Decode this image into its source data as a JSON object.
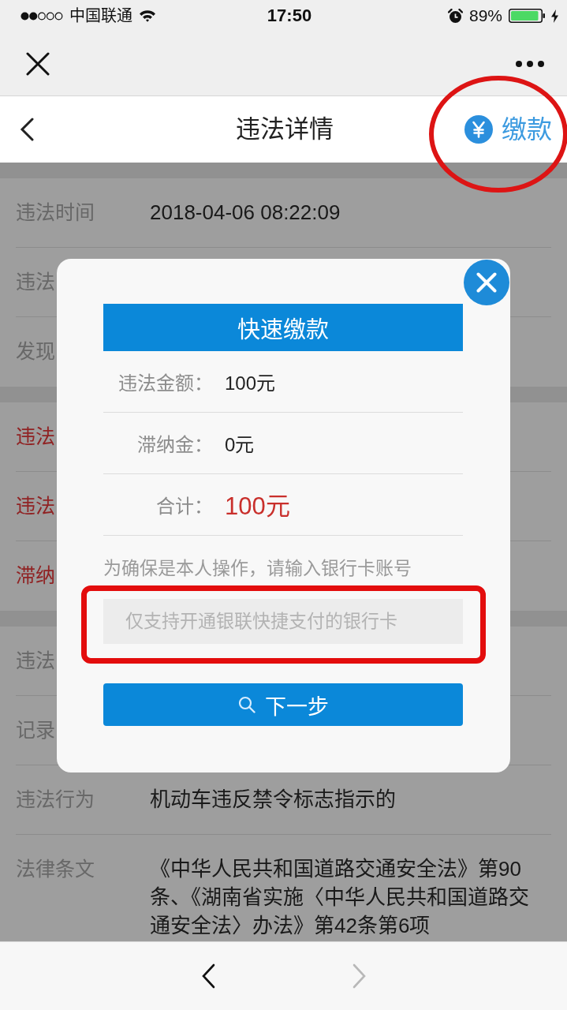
{
  "status_bar": {
    "carrier": "中国联通",
    "time": "17:50",
    "battery": "89%"
  },
  "header": {
    "title": "违法详情",
    "pay_action": {
      "label": "缴款",
      "highlighted": true
    }
  },
  "sections": [
    {
      "rows": [
        {
          "label": "违法时间",
          "value": "2018-04-06 08:22:09",
          "kind": "plain"
        },
        {
          "label": "违法",
          "kind": "plain"
        },
        {
          "label": "发现",
          "kind": "plain"
        }
      ]
    },
    {
      "rows": [
        {
          "label": "违法",
          "kind": "alert"
        },
        {
          "label": "违法",
          "kind": "alert"
        },
        {
          "label": "滞纳",
          "kind": "alert"
        }
      ]
    },
    {
      "rows": [
        {
          "label": "违法",
          "kind": "plain"
        },
        {
          "label": "记录",
          "kind": "plain"
        },
        {
          "label": "违法行为",
          "value": "机动车违反禁令标志指示的",
          "kind": "plain"
        },
        {
          "label": "法律条文",
          "value": "《中华人民共和国道路交通安全法》第90条、《湖南省实施〈中华人民共和国道路交通安全法〉办法》第42条第6项",
          "kind": "plain"
        }
      ]
    }
  ],
  "dialog": {
    "title": "快速缴款",
    "fees": [
      {
        "label": "违法金额：",
        "value": "100元",
        "kind": "amount"
      },
      {
        "label": "滞纳金：",
        "value": "0元",
        "kind": "amount"
      },
      {
        "label": "合计：",
        "value": "100元",
        "kind": "total"
      }
    ],
    "hint": "为确保是本人操作，请输入银行卡账号",
    "card_field": {
      "placeholder": "仅支持开通银联快捷支付的银行卡",
      "highlighted": true
    },
    "submit": {
      "label": "下一步"
    }
  },
  "toolbar": {
    "back": {
      "disabled": false
    },
    "forward": {
      "disabled": true
    }
  }
}
